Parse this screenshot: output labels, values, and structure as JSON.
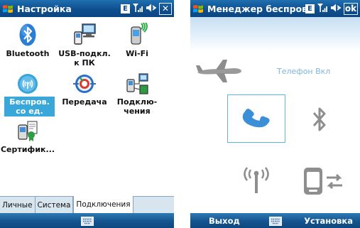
{
  "left_screen": {
    "title": "Настройка",
    "tray": {
      "input_indicator": "E",
      "close_label": "✕"
    },
    "items": [
      {
        "label": "Bluetooth",
        "icon": "bluetooth-icon"
      },
      {
        "label": "USB-подкл. к ПК",
        "icon": "usb-pc-icon"
      },
      {
        "label": "Wi-Fi",
        "icon": "wifi-phone-icon"
      },
      {
        "label": "Беспров. со ед.",
        "icon": "wireless-manager-icon",
        "selected": true
      },
      {
        "label": "Передача",
        "icon": "beam-icon"
      },
      {
        "label": "Подклю- чения",
        "icon": "connections-icon"
      },
      {
        "label": "Сертифик...",
        "icon": "certificates-icon"
      }
    ],
    "tabs": [
      "Личные",
      "Система",
      "Подключения"
    ],
    "active_tab": "Подключения"
  },
  "right_screen": {
    "title": "Менеджер беспровс",
    "tray": {
      "input_indicator": "E",
      "ok_label": "ok"
    },
    "phone_status": "Телефон Вкл",
    "softkeys": {
      "left": "Выход",
      "right": "Установка"
    },
    "accent_color": "#3b8fd6"
  },
  "colors": {
    "titlebar": "#0f4f8f",
    "selection": "#39a7d9",
    "tab_bar": "#d7e5ef"
  }
}
